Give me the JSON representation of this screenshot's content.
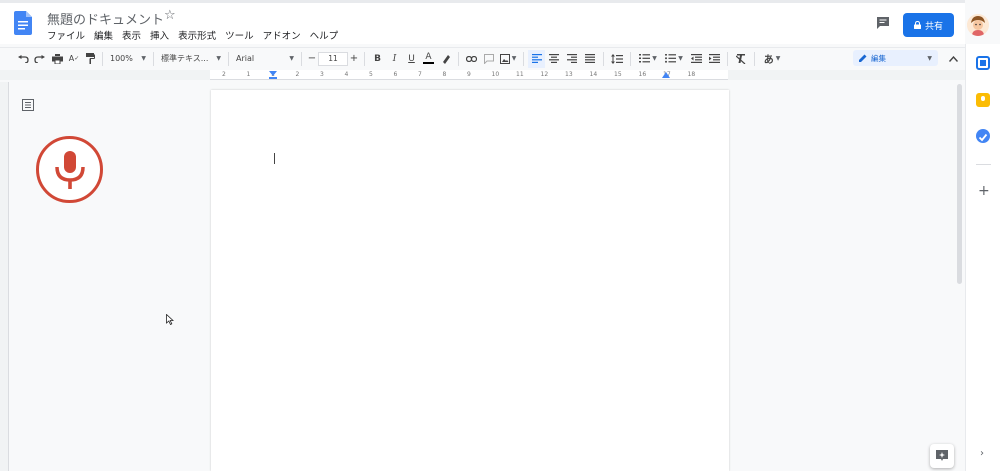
{
  "header": {
    "title": "無題のドキュメント",
    "star": "☆",
    "menus": [
      "ファイル",
      "編集",
      "表示",
      "挿入",
      "表示形式",
      "ツール",
      "アドオン",
      "ヘルプ"
    ],
    "share_label": "共有"
  },
  "toolbar": {
    "zoom": "100%",
    "style": "標準テキス...",
    "font": "Arial",
    "font_size": "11",
    "bold": "B",
    "italic": "I",
    "underline": "U",
    "text_color": "A",
    "input_tool": "あ",
    "mode_label": "編集"
  },
  "ruler": {
    "labels": [
      "2",
      "1",
      "1",
      "2",
      "3",
      "4",
      "5",
      "6",
      "7",
      "8",
      "9",
      "10",
      "11",
      "12",
      "13",
      "14",
      "15",
      "16",
      "17",
      "18"
    ]
  },
  "colors": {
    "accent": "#1a73e8",
    "mic_red": "#d14836",
    "doc_blue": "#4285f4"
  }
}
